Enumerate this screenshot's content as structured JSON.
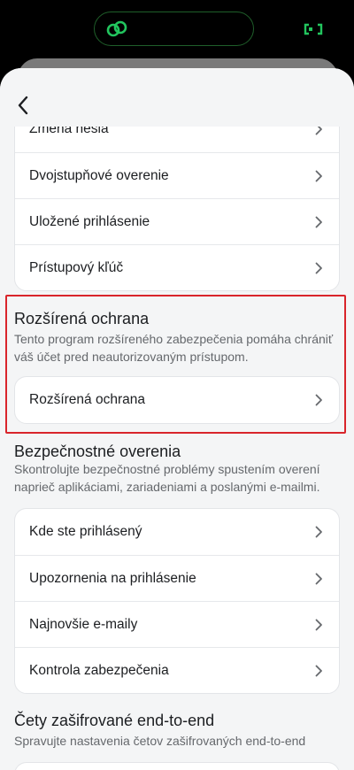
{
  "colors": {
    "highlight": "#d9252b",
    "status_accent": "#22c55e"
  },
  "status_bar": {
    "left_icon": "link-icon",
    "right_icon": "expand-icon"
  },
  "nav": {
    "back_icon": "chevron-left-icon"
  },
  "password_card": {
    "items": [
      {
        "label": "Zmena hesla"
      },
      {
        "label": "Dvojstupňové overenie"
      },
      {
        "label": "Uložené prihlásenie"
      },
      {
        "label": "Prístupový kľúč"
      }
    ]
  },
  "advanced_protection": {
    "title": "Rozšírená ochrana",
    "description": "Tento program rozšíreného zabezpečenia pomáha chrániť váš účet pred neautorizovaným prístupom.",
    "item_label": "Rozšírená ochrana"
  },
  "security_checks": {
    "title": "Bezpečnostné overenia",
    "description": "Skontrolujte bezpečnostné problémy spustením overení naprieč aplikáciami, zariadeniami a poslanými e-mailmi.",
    "items": [
      {
        "label": "Kde ste prihlásený"
      },
      {
        "label": "Upozornenia na prihlásenie"
      },
      {
        "label": "Najnovšie e-maily"
      },
      {
        "label": "Kontrola zabezpečenia"
      }
    ]
  },
  "encrypted_chats": {
    "title": "Čety zašifrované end-to-end",
    "description": "Spravujte nastavenia četov zašifrovaných end-to-end"
  }
}
